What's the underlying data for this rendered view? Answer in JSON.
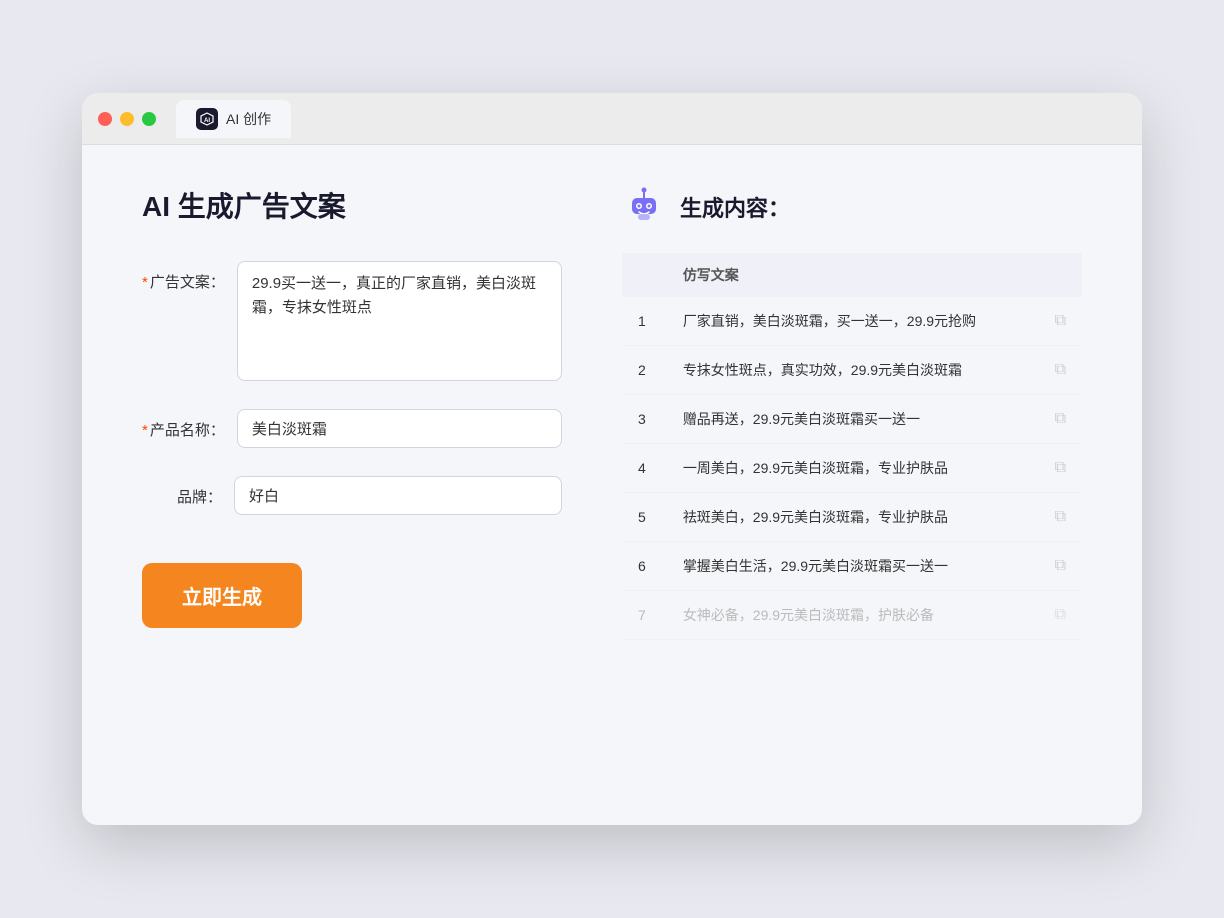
{
  "tab": {
    "title": "AI 创作"
  },
  "left": {
    "page_title": "AI 生成广告文案",
    "fields": [
      {
        "label": "广告文案：",
        "required": true,
        "type": "textarea",
        "value": "29.9买一送一，真正的厂家直销，美白淡斑霜，专抹女性斑点",
        "placeholder": ""
      },
      {
        "label": "产品名称：",
        "required": true,
        "type": "input",
        "value": "美白淡斑霜",
        "placeholder": ""
      },
      {
        "label": "品牌：",
        "required": false,
        "type": "input",
        "value": "好白",
        "placeholder": ""
      }
    ],
    "button_label": "立即生成"
  },
  "right": {
    "title": "生成内容：",
    "table_header": "仿写文案",
    "results": [
      {
        "num": "1",
        "text": "厂家直销，美白淡斑霜，买一送一，29.9元抢购",
        "faded": false
      },
      {
        "num": "2",
        "text": "专抹女性斑点，真实功效，29.9元美白淡斑霜",
        "faded": false
      },
      {
        "num": "3",
        "text": "赠品再送，29.9元美白淡斑霜买一送一",
        "faded": false
      },
      {
        "num": "4",
        "text": "一周美白，29.9元美白淡斑霜，专业护肤品",
        "faded": false
      },
      {
        "num": "5",
        "text": "祛斑美白，29.9元美白淡斑霜，专业护肤品",
        "faded": false
      },
      {
        "num": "6",
        "text": "掌握美白生活，29.9元美白淡斑霜买一送一",
        "faded": false
      },
      {
        "num": "7",
        "text": "女神必备，29.9元美白淡斑霜，护肤必备",
        "faded": true
      }
    ]
  }
}
